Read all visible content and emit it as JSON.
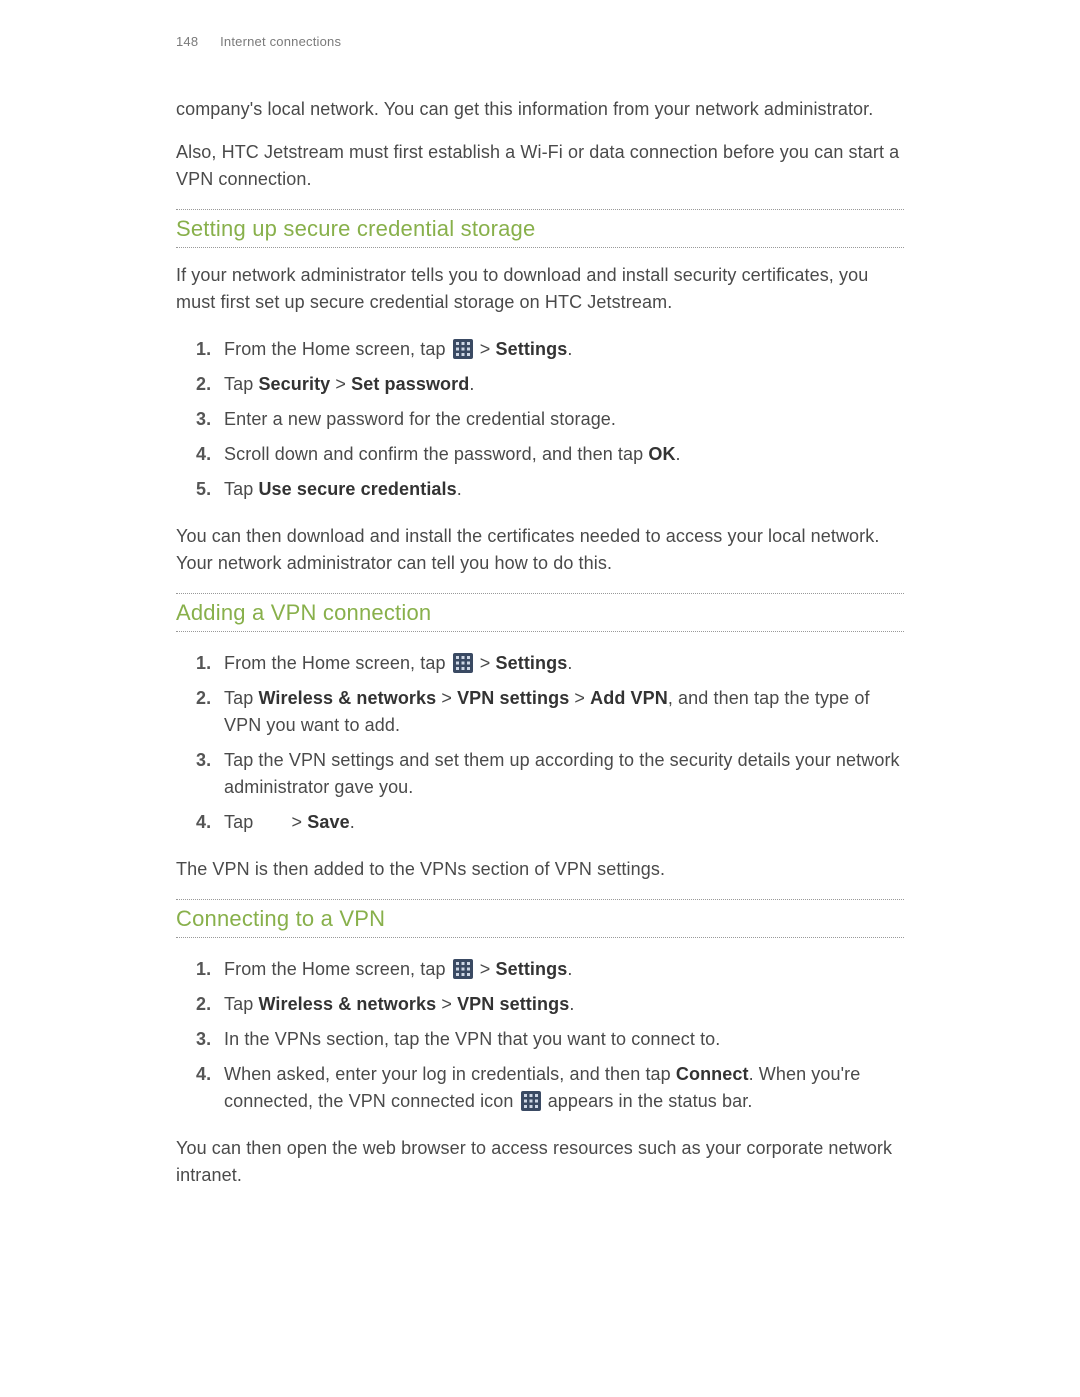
{
  "header": {
    "page_number": "148",
    "section": "Internet connections"
  },
  "intro": {
    "p1": "company's local network. You can get this information from your network administrator.",
    "p2": "Also, HTC Jetstream must first establish a Wi-Fi or data connection before you can start a VPN connection."
  },
  "sec1": {
    "heading": "Setting up secure credential storage",
    "lead": "If your network administrator tells you to download and install security certificates, you must first set up secure credential storage on HTC Jetstream.",
    "step1_a": "From the Home screen, tap ",
    "step1_b": " > ",
    "step1_settings": "Settings",
    "step1_c": ".",
    "step2_a": "Tap ",
    "step2_sec": "Security",
    "step2_b": " > ",
    "step2_setpw": "Set password",
    "step2_c": ".",
    "step3": "Enter a new password for the credential storage.",
    "step4_a": "Scroll down and confirm the password, and then tap ",
    "step4_ok": "OK",
    "step4_b": ".",
    "step5_a": "Tap ",
    "step5_use": "Use secure credentials",
    "step5_b": ".",
    "tail": "You can then download and install the certificates needed to access your local network. Your network administrator can tell you how to do this."
  },
  "sec2": {
    "heading": "Adding a VPN connection",
    "step1_a": "From the Home screen, tap ",
    "step1_b": " > ",
    "step1_settings": "Settings",
    "step1_c": ".",
    "step2_a": "Tap ",
    "step2_wn": "Wireless & networks",
    "step2_b": " > ",
    "step2_vpn": "VPN settings",
    "step2_c": " > ",
    "step2_add": "Add VPN",
    "step2_d": ", and then tap the type of VPN you want to add.",
    "step3": "Tap the VPN settings and set them up according to the security details your network administrator gave you.",
    "step4_a": "Tap ",
    "step4_b": " > ",
    "step4_save": "Save",
    "step4_c": ".",
    "tail": "The VPN is then added to the VPNs section of VPN settings."
  },
  "sec3": {
    "heading": "Connecting to a VPN",
    "step1_a": "From the Home screen, tap ",
    "step1_b": " > ",
    "step1_settings": "Settings",
    "step1_c": ".",
    "step2_a": "Tap ",
    "step2_wn": "Wireless & networks",
    "step2_b": " > ",
    "step2_vpn": "VPN settings",
    "step2_c": ".",
    "step3": "In the VPNs section, tap the VPN that you want to connect to.",
    "step4_a": "When asked, enter your log in credentials, and then tap ",
    "step4_connect": "Connect",
    "step4_b": ". When you're connected, the VPN connected icon ",
    "step4_c": " appears in the status bar.",
    "tail": "You can then open the web browser to access resources such as your corporate network intranet."
  },
  "icons": {
    "apps": "apps-grid-icon"
  }
}
